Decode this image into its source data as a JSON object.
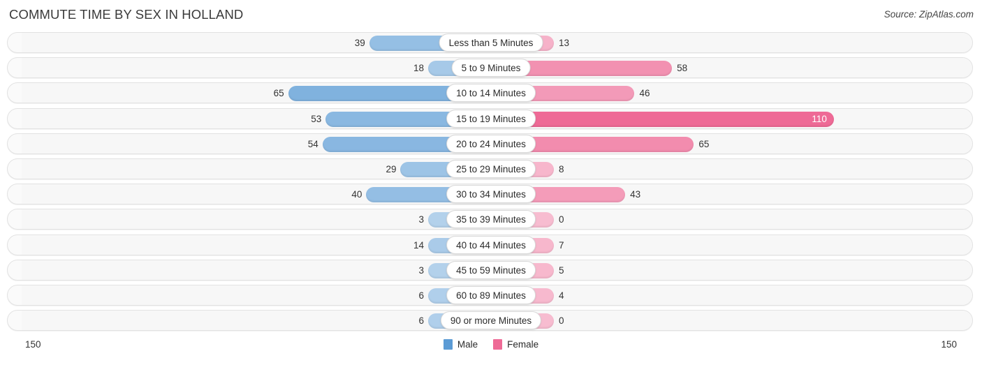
{
  "header": {
    "title": "COMMUTE TIME BY SEX IN HOLLAND",
    "source": "Source: ZipAtlas.com"
  },
  "legend": {
    "male_label": "Male",
    "female_label": "Female",
    "male_color": "#5b9bd5",
    "female_color": "#ee6a96"
  },
  "axis": {
    "left_max_label": "150",
    "right_max_label": "150"
  },
  "chart_data": {
    "type": "bar",
    "orientation": "horizontal-diverging",
    "title": "COMMUTE TIME BY SEX IN HOLLAND",
    "xlabel": "",
    "ylabel": "",
    "axis_max": 150,
    "grid": false,
    "legend_position": "bottom-center",
    "categories": [
      "Less than 5 Minutes",
      "5 to 9 Minutes",
      "10 to 14 Minutes",
      "15 to 19 Minutes",
      "20 to 24 Minutes",
      "25 to 29 Minutes",
      "30 to 34 Minutes",
      "35 to 39 Minutes",
      "40 to 44 Minutes",
      "45 to 59 Minutes",
      "60 to 89 Minutes",
      "90 or more Minutes"
    ],
    "series": [
      {
        "name": "Male",
        "color": "#5b9bd5",
        "values": [
          39,
          18,
          65,
          53,
          54,
          29,
          40,
          3,
          14,
          3,
          6,
          6
        ]
      },
      {
        "name": "Female",
        "color": "#ee6a96",
        "values": [
          13,
          58,
          46,
          110,
          65,
          8,
          43,
          0,
          7,
          5,
          4,
          0
        ]
      }
    ]
  }
}
